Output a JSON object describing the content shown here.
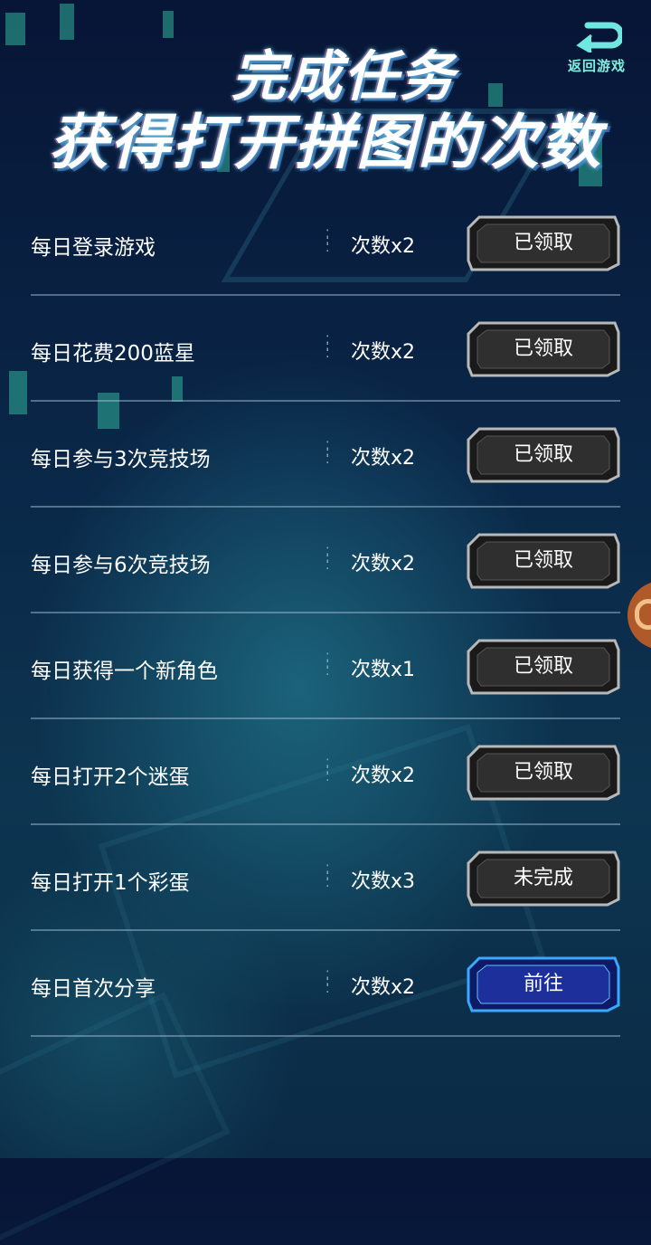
{
  "header": {
    "title_line1": "完成任务",
    "title_line2": "获得打开拼图的次数",
    "back_label": "返回游戏",
    "back_icon": "return-arrow-icon"
  },
  "tasks": [
    {
      "name": "每日登录游戏",
      "reward": "次数x2",
      "button": "已领取",
      "state": "claimed"
    },
    {
      "name": "每日花费200蓝星",
      "reward": "次数x2",
      "button": "已领取",
      "state": "claimed"
    },
    {
      "name": "每日参与3次竞技场",
      "reward": "次数x2",
      "button": "已领取",
      "state": "claimed"
    },
    {
      "name": "每日参与6次竞技场",
      "reward": "次数x2",
      "button": "已领取",
      "state": "claimed"
    },
    {
      "name": "每日获得一个新角色",
      "reward": "次数x1",
      "button": "已领取",
      "state": "claimed"
    },
    {
      "name": "每日打开2个迷蛋",
      "reward": "次数x2",
      "button": "已领取",
      "state": "claimed"
    },
    {
      "name": "每日打开1个彩蛋",
      "reward": "次数x3",
      "button": "未完成",
      "state": "incomplete"
    },
    {
      "name": "每日首次分享",
      "reward": "次数x2",
      "button": "前往",
      "state": "go"
    }
  ],
  "colors": {
    "accent_teal": "#7ff0e0",
    "button_dark": "#2a2a2a",
    "button_go": "#1a2a8a",
    "divider": "#aac8dc"
  }
}
